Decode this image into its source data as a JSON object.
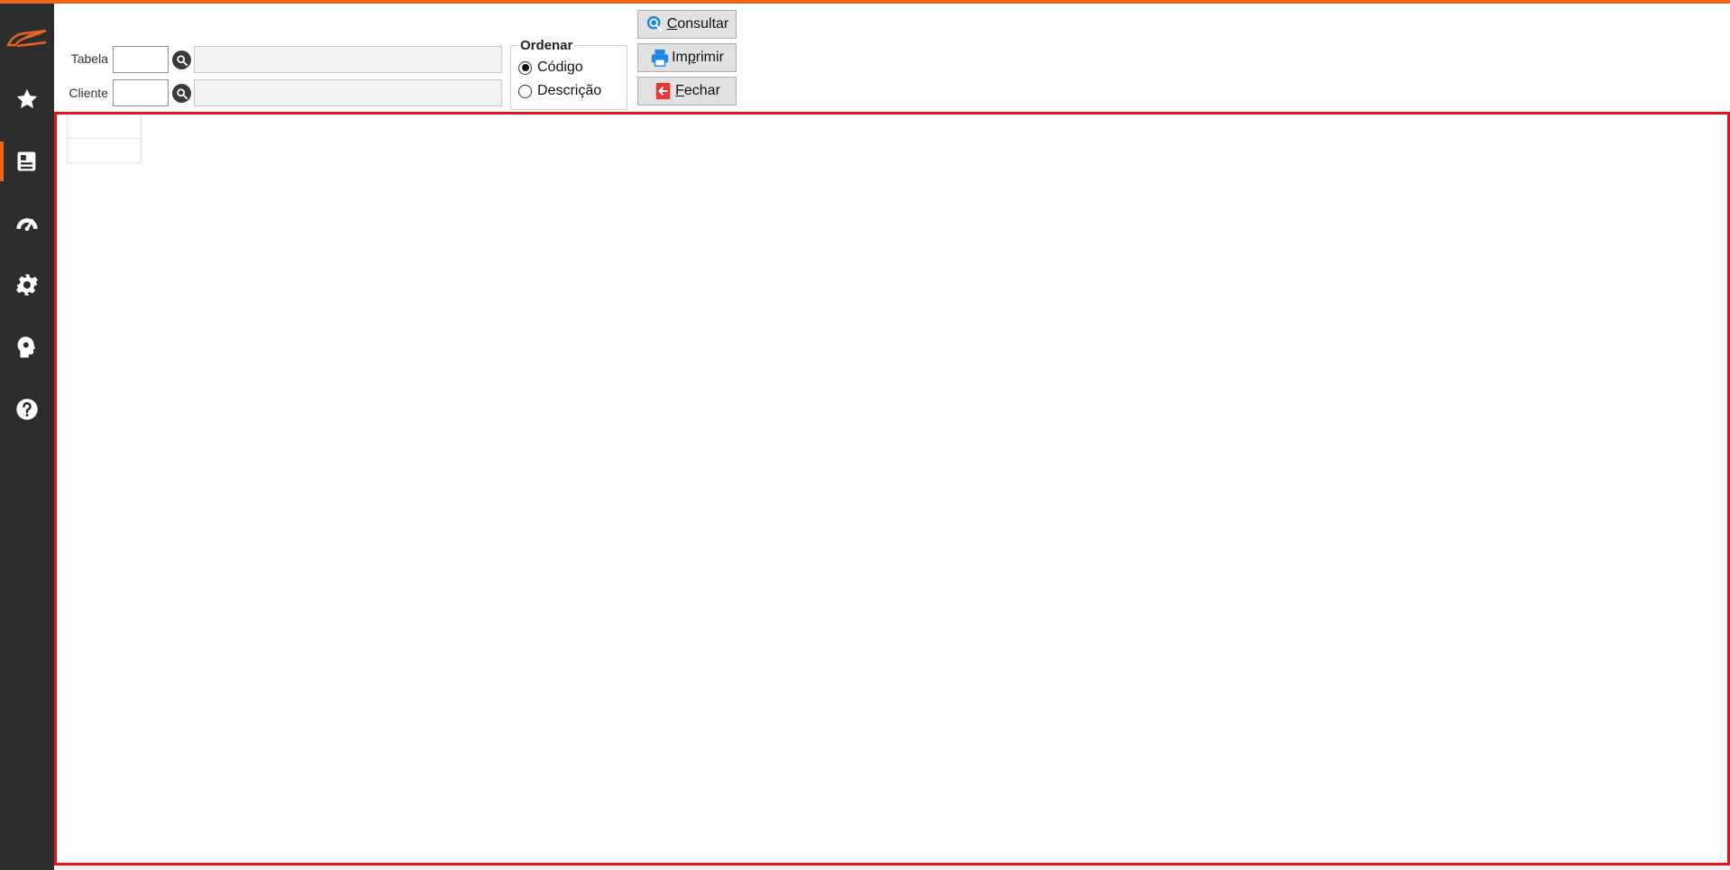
{
  "colors": {
    "accent": "#e8661e",
    "sidebar_bg": "#2d2d2d",
    "grid_border": "#e3141b",
    "consultar_icon": "#1e88e5",
    "imprimir_icon": "#1e88e5",
    "fechar_icon": "#e53935"
  },
  "sidebar": {
    "logo_icon": "brand-logo-icon",
    "items": [
      {
        "icon": "star-icon",
        "active": false
      },
      {
        "icon": "document-list-icon",
        "active": true
      },
      {
        "icon": "speedometer-icon",
        "active": false
      },
      {
        "icon": "gear-icon",
        "active": false
      },
      {
        "icon": "head-gear-icon",
        "active": false
      },
      {
        "icon": "help-icon",
        "active": false
      }
    ]
  },
  "filters": {
    "tabela": {
      "label": "Tabela",
      "code_value": "",
      "description_value": ""
    },
    "cliente": {
      "label": "Cliente",
      "code_value": "",
      "description_value": ""
    }
  },
  "ordenar": {
    "title": "Ordenar",
    "options": [
      {
        "label": "Código",
        "selected": true
      },
      {
        "label": "Descrição",
        "selected": false
      }
    ]
  },
  "actions": {
    "consultar": {
      "prefix": "",
      "mnemonic": "C",
      "suffix": "onsultar",
      "icon": "search-icon"
    },
    "imprimir": {
      "prefix": "Im",
      "mnemonic": "p",
      "suffix": "rimir",
      "icon": "printer-icon"
    },
    "fechar": {
      "prefix": "",
      "mnemonic": "F",
      "suffix": "echar",
      "icon": "exit-icon"
    }
  }
}
